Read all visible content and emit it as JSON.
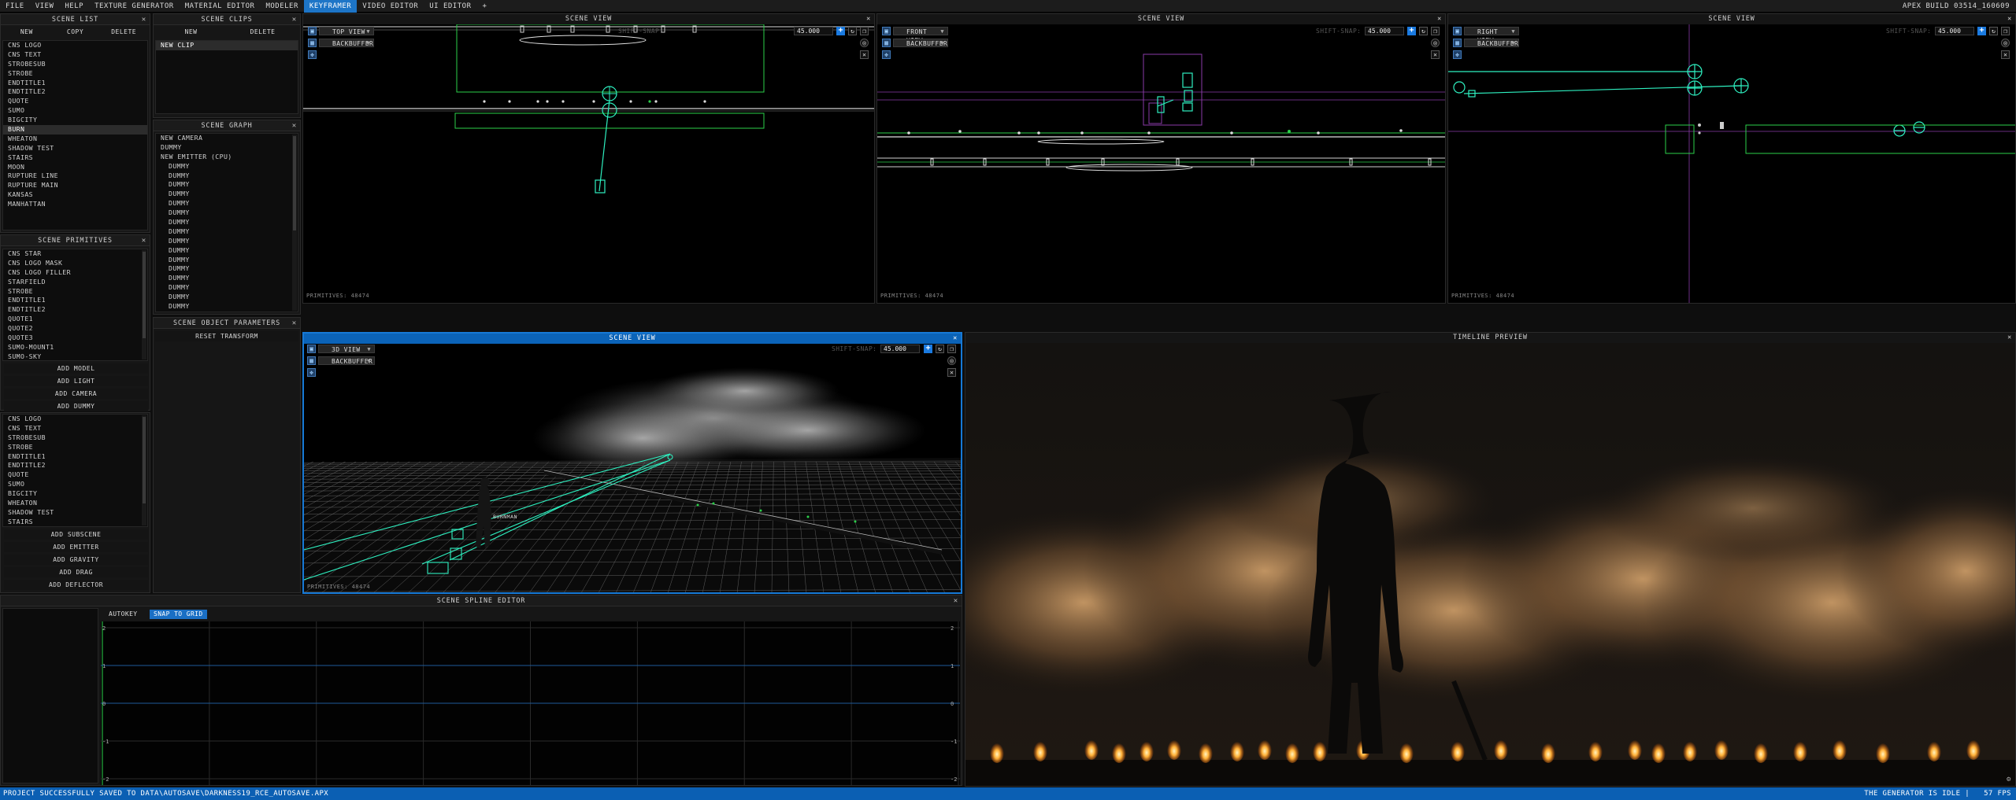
{
  "menubar": {
    "items": [
      "FILE",
      "VIEW",
      "HELP",
      "TEXTURE GENERATOR",
      "MATERIAL EDITOR",
      "MODELER",
      "KEYFRAMER",
      "VIDEO EDITOR",
      "UI EDITOR",
      "+"
    ],
    "active": "KEYFRAMER",
    "build": "APEX BUILD 03514_160609"
  },
  "scene_list": {
    "title": "SCENE LIST",
    "buttons": [
      "NEW",
      "COPY",
      "DELETE"
    ],
    "items": [
      "CNS LOGO",
      "CNS TEXT",
      "STROBESUB",
      "STROBE",
      "ENDTITLE1",
      "ENDTITLE2",
      "QUOTE",
      "SUMO",
      "BIGCITY",
      "BURN",
      "WHEATON",
      "SHADOW TEST",
      "STAIRS",
      "MOON",
      "RUPTURE LINE",
      "RUPTURE MAIN",
      "KANSAS",
      "MANHATTAN"
    ],
    "selected": "BURN"
  },
  "scene_clips": {
    "title": "SCENE CLIPS",
    "buttons": [
      "NEW",
      "DELETE"
    ],
    "items": [
      "NEW CLIP"
    ]
  },
  "scene_graph": {
    "title": "SCENE GRAPH",
    "items": [
      "NEW CAMERA",
      "DUMMY",
      "NEW EMITTER (CPU)"
    ],
    "children": [
      "DUMMY",
      "DUMMY",
      "DUMMY",
      "DUMMY",
      "DUMMY",
      "DUMMY",
      "DUMMY",
      "DUMMY",
      "DUMMY",
      "DUMMY",
      "DUMMY",
      "DUMMY",
      "DUMMY",
      "DUMMY",
      "DUMMY",
      "DUMMY"
    ]
  },
  "scene_object_parameters": {
    "title": "SCENE OBJECT PARAMETERS",
    "button": "RESET TRANSFORM"
  },
  "scene_primitives": {
    "title": "SCENE PRIMITIVES",
    "items": [
      "CNS STAR",
      "CNS LOGO MASK",
      "CNS LOGO FILLER",
      "STARFIELD",
      "STROBE",
      "ENDTITLE1",
      "ENDTITLE2",
      "QUOTE1",
      "QUOTE2",
      "QUOTE3",
      "SUMO-MOUNT1",
      "SUMO-SKY"
    ],
    "buttons": [
      "ADD MODEL",
      "ADD LIGHT",
      "ADD CAMERA",
      "ADD DUMMY"
    ]
  },
  "subscenes": {
    "items": [
      "CNS LOGO",
      "CNS TEXT",
      "STROBESUB",
      "STROBE",
      "ENDTITLE1",
      "ENDTITLE2",
      "QUOTE",
      "SUMO",
      "BIGCITY",
      "WHEATON",
      "SHADOW TEST",
      "STAIRS"
    ],
    "buttons": [
      "ADD SUBSCENE",
      "ADD EMITTER",
      "ADD GRAVITY",
      "ADD DRAG",
      "ADD DEFLECTOR"
    ]
  },
  "viewports": {
    "title": "SCENE VIEW",
    "top": {
      "view": "TOP VIEW",
      "buffer": "BACKBUFFER",
      "snap_label": "SHIFT-SNAP:",
      "snap_value": "45.000",
      "primitives": "PRIMITIVES: 48474"
    },
    "front": {
      "view": "FRONT VIEW",
      "buffer": "BACKBUFFER",
      "snap_label": "SHIFT-SNAP:",
      "snap_value": "45.000",
      "primitives": "PRIMITIVES: 48474"
    },
    "right": {
      "view": "RIGHT VIEW",
      "buffer": "BACKBUFFER",
      "snap_label": "SHIFT-SNAP:",
      "snap_value": "45.000",
      "primitives": "PRIMITIVES: 48474"
    },
    "persp": {
      "view": "3D VIEW",
      "buffer": "BACKBUFFER",
      "snap_label": "SHIFT-SNAP:",
      "snap_value": "45.000",
      "primitives": "PRIMITIVES: 48474",
      "object_label": "BURNMAN"
    }
  },
  "timeline_preview": {
    "title": "TIMELINE PREVIEW"
  },
  "spline_editor": {
    "title": "SCENE SPLINE EDITOR",
    "autokey": "AUTOKEY",
    "snap": "SNAP TO GRID",
    "y_labels_left": [
      "2",
      "1",
      "0",
      "-1",
      "-2"
    ],
    "y_labels_right": [
      "2",
      "1",
      "0",
      "-1",
      "-2"
    ]
  },
  "status": {
    "message": "PROJECT SUCCESSFULLY SAVED TO DATA\\AUTOSAVE\\DARKNESS19_RCE_AUTOSAVE.APX",
    "idle": "THE GENERATOR IS IDLE |",
    "fps": "57 FPS"
  },
  "colors": {
    "accent": "#1d75c7",
    "wire": "#2ef0c0",
    "green": "#2bd04a",
    "purple": "#8a3aa8"
  }
}
